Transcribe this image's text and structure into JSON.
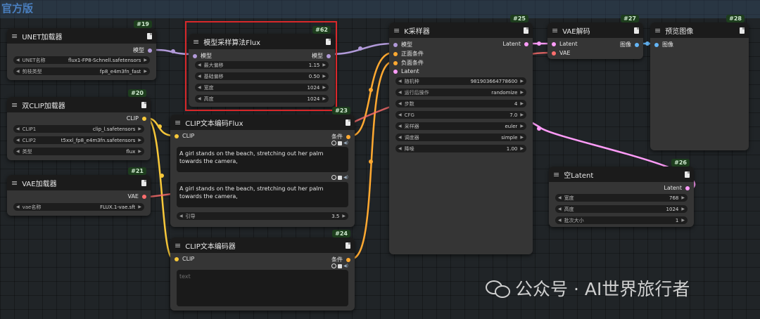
{
  "group": {
    "title": "官方版"
  },
  "colors": {
    "model": "#b19ad9",
    "clip": "#f7c83a",
    "vae": "#ff6e6e",
    "latent": "#ff9cf9",
    "conditioning": "#ffa931",
    "image": "#64b5f6",
    "highlight": "#d8282a"
  },
  "icons": {
    "menu": "hamburger-icon",
    "doc": "document-icon",
    "arrow_left": "◀",
    "arrow_right": "▶"
  },
  "nodes": {
    "unet": {
      "id": "#19",
      "title": "UNET加载器",
      "output": "模型",
      "widgets": [
        {
          "label": "UNET名称",
          "value": "flux1-FP8-Schnell.safetensors"
        },
        {
          "label": "剪枝类型",
          "value": "fp8_e4m3fn_fast"
        }
      ]
    },
    "sampling": {
      "id": "#62",
      "title": "模型采样算法Flux",
      "input": "模型",
      "output": "模型",
      "widgets": [
        {
          "label": "最大偏移",
          "value": "1.15"
        },
        {
          "label": "基础偏移",
          "value": "0.50"
        },
        {
          "label": "宽度",
          "value": "1024"
        },
        {
          "label": "高度",
          "value": "1024"
        }
      ]
    },
    "dualclip": {
      "id": "#20",
      "title": "双CLIP加载器",
      "output": "CLIP",
      "widgets": [
        {
          "label": "CLIP1",
          "value": "clip_l.safetensors"
        },
        {
          "label": "CLIP2",
          "value": "t5xxl_fp8_e4m3fn.safetensors"
        },
        {
          "label": "类型",
          "value": "flux"
        }
      ]
    },
    "vaeloader": {
      "id": "#21",
      "title": "VAE加载器",
      "output": "VAE",
      "widgets": [
        {
          "label": "vae名称",
          "value": "FLUX.1-vae.sft"
        }
      ]
    },
    "clipflux": {
      "id": "#23",
      "title": "CLIP文本编码Flux",
      "input": "CLIP",
      "output": "条件",
      "text1": "A girl stands on the beach, stretching out her palm towards the camera,",
      "text2": "A girl stands on the beach, stretching out her palm towards the camera,",
      "widgets": [
        {
          "label": "引导",
          "value": "3.5"
        }
      ]
    },
    "cliptext": {
      "id": "#24",
      "title": "CLIP文本编码器",
      "input": "CLIP",
      "output": "条件",
      "placeholder": "text"
    },
    "ksampler": {
      "id": "#25",
      "title": "K采样器",
      "output": "Latent",
      "inputs": [
        "模型",
        "正面条件",
        "负面条件",
        "Latent"
      ],
      "widgets": [
        {
          "label": "随机种",
          "value": "981903664778600"
        },
        {
          "label": "运行后操作",
          "value": "randomize"
        },
        {
          "label": "步数",
          "value": "4"
        },
        {
          "label": "CFG",
          "value": "7.0"
        },
        {
          "label": "采样器",
          "value": "euler"
        },
        {
          "label": "调度器",
          "value": "simple"
        },
        {
          "label": "降噪",
          "value": "1.00"
        }
      ]
    },
    "vaedecode": {
      "id": "#27",
      "title": "VAE解码",
      "inputs": [
        "Latent",
        "VAE"
      ],
      "output": "图像"
    },
    "preview": {
      "id": "#28",
      "title": "预览图像",
      "input": "图像"
    },
    "emptylatent": {
      "id": "#26",
      "title": "空Latent",
      "output": "Latent",
      "widgets": [
        {
          "label": "宽度",
          "value": "768"
        },
        {
          "label": "高度",
          "value": "1024"
        },
        {
          "label": "批次大小",
          "value": "1"
        }
      ]
    }
  },
  "watermark": {
    "text": "公众号 · AI世界旅行者"
  }
}
